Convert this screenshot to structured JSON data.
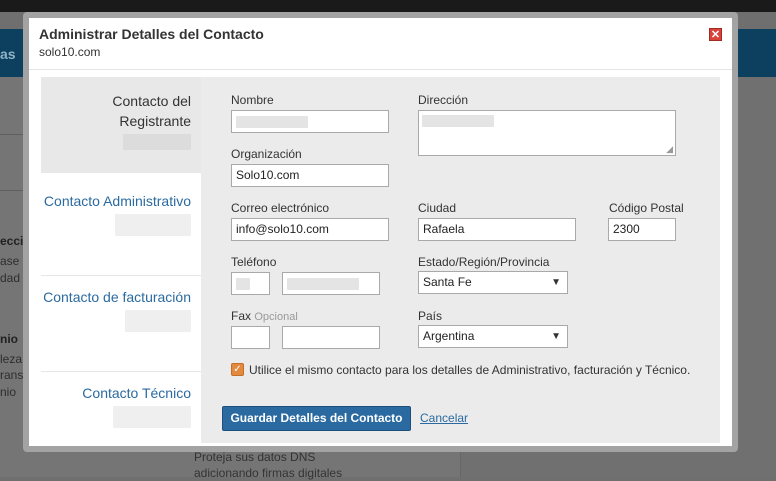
{
  "background": {
    "nav_fragment": "as",
    "sidebar_fragments": [
      "ecci",
      "ase",
      "dad y",
      "nio",
      "leza",
      "rans",
      "nio"
    ],
    "footer_lines": [
      "Proteja sus datos DNS",
      "adicionando firmas digitales"
    ]
  },
  "modal": {
    "title": "Administrar Detalles del Contacto",
    "subtitle": "solo10.com",
    "close_icon": "close-icon",
    "accent_color": "#d9423a"
  },
  "tabs": [
    {
      "label": "Contacto del Registrante",
      "active": true
    },
    {
      "label": "Contacto Administrativo",
      "active": false
    },
    {
      "label": "Contacto de facturación",
      "active": false
    },
    {
      "label": "Contacto Técnico",
      "active": false
    }
  ],
  "form": {
    "nombre_label": "Nombre",
    "organizacion_label": "Organización",
    "organizacion_value": "Solo10.com",
    "direccion_label": "Dirección",
    "correo_label": "Correo electrónico",
    "correo_value": "info@solo10.com",
    "ciudad_label": "Ciudad",
    "ciudad_value": "Rafaela",
    "codigo_postal_label": "Código Postal",
    "codigo_postal_value": "2300",
    "telefono_label": "Teléfono",
    "estado_label": "Estado/Región/Provincia",
    "estado_value": "Santa Fe",
    "fax_label": "Fax",
    "fax_optional": "Opcional",
    "pais_label": "País",
    "pais_value": "Argentina",
    "same_contact_label": "Utilice el mismo contacto para los detalles de Administrativo, facturación y Técnico.",
    "same_contact_checked": true
  },
  "actions": {
    "save_label": "Guardar Detalles del Contacto",
    "cancel_label": "Cancelar"
  },
  "colors": {
    "link": "#2a6aa0",
    "primary_button": "#2a6aa0",
    "checkbox": "#e38a3e"
  }
}
